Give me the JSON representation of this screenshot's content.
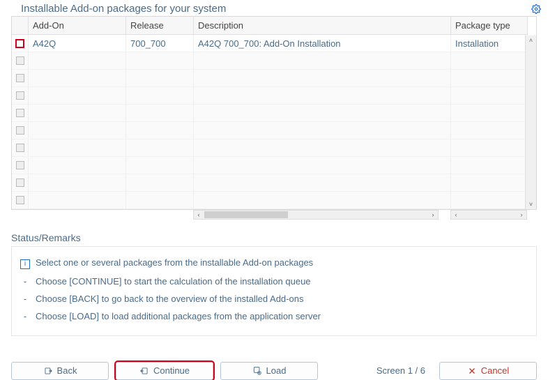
{
  "header": {
    "title": "Installable Add-on packages for your system"
  },
  "columns": {
    "c0": "",
    "c1": "Add-On",
    "c2": "Release",
    "c3": "Description",
    "c4": "Package type"
  },
  "rows": [
    {
      "addon": "A42Q",
      "release": "700_700",
      "description": "A42Q 700_700: Add-On Installation",
      "ptype": "Installation"
    }
  ],
  "status": {
    "title": "Status/Remarks",
    "line_info": "Select one or several packages from the installable Add-on packages",
    "line_continue": "Choose [CONTINUE] to start the calculation of the installation queue",
    "line_back": "Choose [BACK] to go back to the overview of the installed Add-ons",
    "line_load": "Choose [LOAD] to load additional packages from the application server"
  },
  "footer": {
    "back": "Back",
    "continue": "Continue",
    "load": "Load",
    "screen": "Screen 1 / 6",
    "cancel": "Cancel"
  }
}
